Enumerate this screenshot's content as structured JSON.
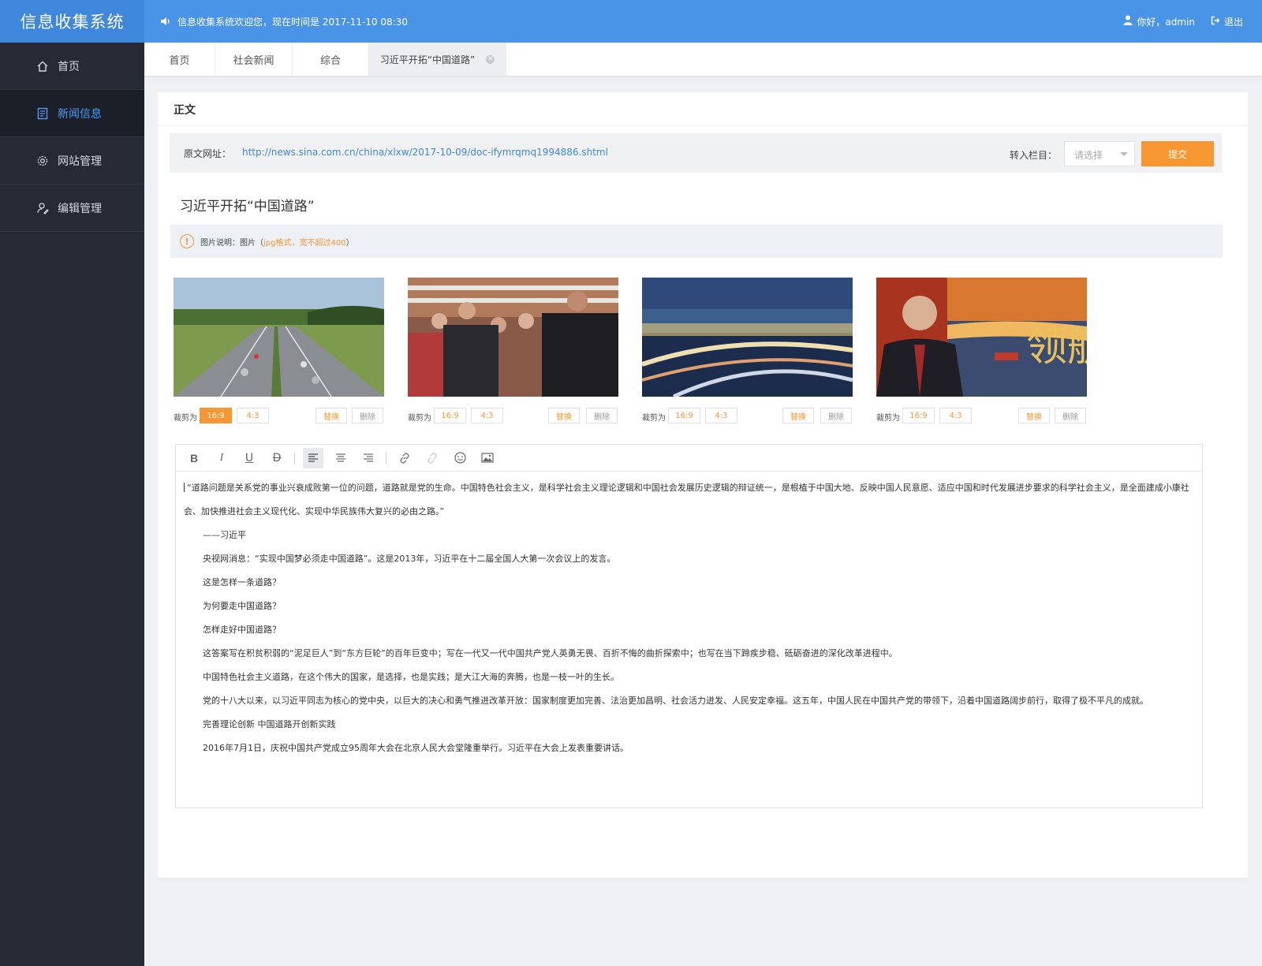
{
  "app": {
    "title": "信息收集系统"
  },
  "header": {
    "welcome": "信息收集系统欢迎您，现在时间是 2017-11-10 08:30",
    "greeting": "你好，admin",
    "logout": "退出"
  },
  "sidebar": {
    "items": [
      {
        "label": "首页",
        "icon": "home-icon"
      },
      {
        "label": "新闻信息",
        "icon": "news-icon",
        "active": true
      },
      {
        "label": "网站管理",
        "icon": "gear-icon"
      },
      {
        "label": "编辑管理",
        "icon": "user-edit-icon"
      }
    ]
  },
  "tabs": [
    {
      "label": "首页"
    },
    {
      "label": "社会新闻"
    },
    {
      "label": "综合"
    },
    {
      "label": "习近平开拓“中国道路”",
      "active": true,
      "closable": true
    }
  ],
  "card": {
    "title": "正文",
    "source_label": "原文网址：",
    "source_url": "http://news.sina.com.cn/china/xlxw/2017-10-09/doc-ifymrqmq1994886.shtml",
    "column_label": "转入栏目：",
    "column_placeholder": "请选择",
    "submit_label": "提交",
    "article_title": "习近平开拓“中国道路”",
    "note_prefix": "图片说明：图片（",
    "note_highlight": "jpg格式，宽不超过400",
    "note_suffix": "）"
  },
  "images": [
    {
      "alt": "highway-photo",
      "crop_label": "裁剪为",
      "ratio_169": "16:9",
      "ratio_43": "4:3",
      "selected": "16:9",
      "replace": "替换",
      "delete": "删除"
    },
    {
      "alt": "crowd-photo",
      "crop_label": "裁剪为",
      "ratio_169": "16:9",
      "ratio_43": "4:3",
      "selected": "",
      "replace": "替换",
      "delete": "删除"
    },
    {
      "alt": "port-night-photo",
      "crop_label": "裁剪为",
      "ratio_169": "16:9",
      "ratio_43": "4:3",
      "selected": "",
      "replace": "替换",
      "delete": "删除"
    },
    {
      "alt": "leader-poster-photo",
      "crop_label": "裁剪为",
      "ratio_169": "16:9",
      "ratio_43": "4:3",
      "selected": "",
      "replace": "替换",
      "delete": "删除"
    }
  ],
  "editor": {
    "toolbar": [
      "bold-icon",
      "italic-icon",
      "underline-icon",
      "strikethrough-icon",
      "align-left-icon",
      "align-center-icon",
      "align-right-icon",
      "link-icon",
      "unlink-icon",
      "emoji-icon",
      "image-icon"
    ],
    "paragraphs": [
      "“道路问题是关系党的事业兴衰成败第一位的问题，道路就是党的生命。中国特色社会主义，是科学社会主义理论逻辑和中国社会发展历史逻辑的辩证统一，是根植于中国大地、反映中国人民意愿、适应中国和时代发展进步要求的科学社会主义，是全面建成小康社会、加快推进社会主义现代化、实现中华民族伟大复兴的必由之路。”",
      "——习近平",
      "央视网消息：“实现中国梦必须走中国道路”。这是2013年，习近平在十二届全国人大第一次会议上的发言。",
      "这是怎样一条道路？",
      "为何要走中国道路？",
      "怎样走好中国道路？",
      "这答案写在积贫积弱的“泥足巨人”到“东方巨轮”的百年巨变中；写在一代又一代中国共产党人英勇无畏、百折不悔的曲折探索中；也写在当下蹄疾步稳、砥砺奋进的深化改革进程中。",
      "中国特色社会主义道路，在这个伟大的国家，是选择，也是实践；是大江大海的奔腾，也是一枝一叶的生长。",
      "党的十八大以来，以习近平同志为核心的党中央，以巨大的决心和勇气推进改革开放：国家制度更加完善、法治更加昌明、社会活力迸发、人民安定幸福。这五年，中国人民在中国共产党的带领下，沿着中国道路阔步前行，取得了极不平凡的成就。",
      "完善理论创新 中国道路开创新实践",
      "2016年7月1日，庆祝中国共产党成立95周年大会在北京人民大会堂隆重举行。习近平在大会上发表重要讲话。"
    ]
  }
}
